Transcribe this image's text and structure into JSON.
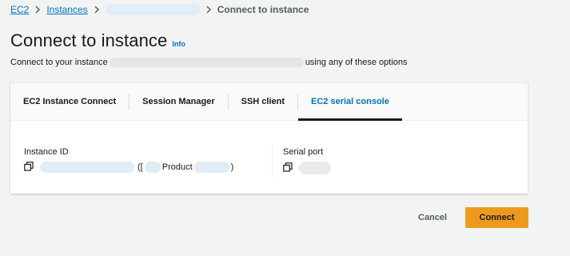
{
  "breadcrumb": {
    "ec2": "EC2",
    "instances": "Instances",
    "current": "Connect to instance"
  },
  "header": {
    "title": "Connect to instance",
    "info": "Info",
    "subtitle_prefix": "Connect to your instance",
    "subtitle_suffix": "using any of these options"
  },
  "tabs": [
    {
      "label": "EC2 Instance Connect"
    },
    {
      "label": "Session Manager"
    },
    {
      "label": "SSH client"
    },
    {
      "label": "EC2 serial console",
      "active": true
    }
  ],
  "fields": {
    "instance_id_label": "Instance ID",
    "instance_open": "([",
    "instance_product": "Product",
    "instance_close": ")",
    "serial_port_label": "Serial port"
  },
  "actions": {
    "cancel": "Cancel",
    "connect": "Connect"
  },
  "colors": {
    "accent_link": "#0073bb",
    "primary_button": "#ec9a1e"
  },
  "icons": [
    "chevron-right-icon",
    "copy-icon"
  ]
}
